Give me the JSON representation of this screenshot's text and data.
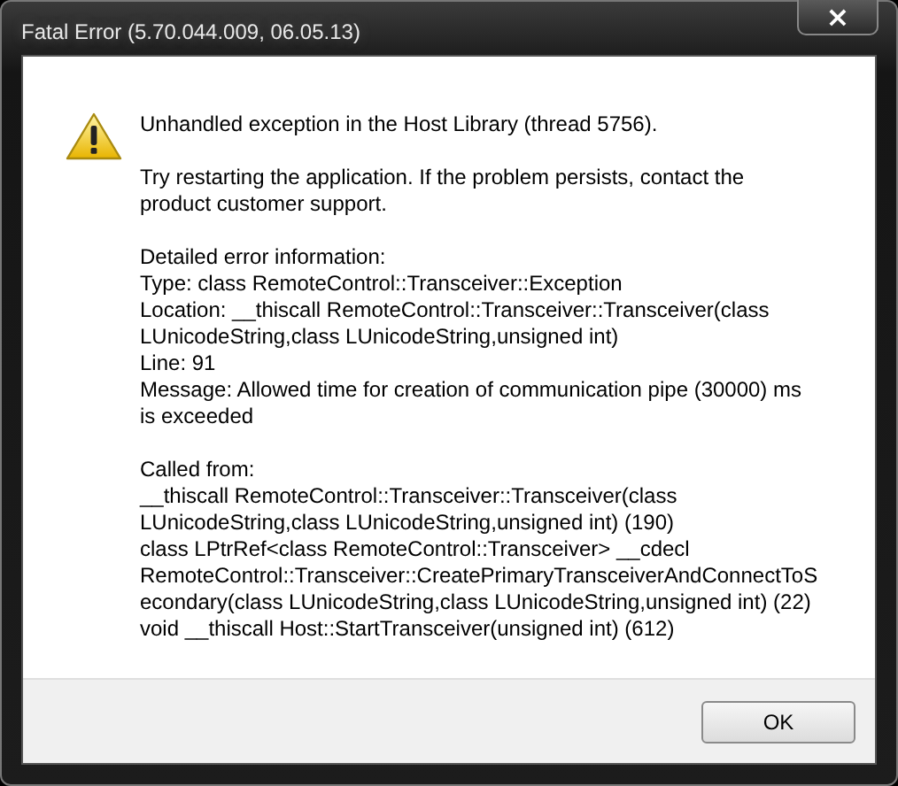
{
  "window": {
    "title": "Fatal Error (5.70.044.009, 06.05.13)",
    "close": "×"
  },
  "message": {
    "headline": [
      "Unhandled exception in the Host Library (thread 5756)."
    ],
    "paragraphs": [
      [
        "Try restarting the application. If the problem persists, contact the",
        "product customer support."
      ],
      [
        "Detailed error information:",
        "Type: class RemoteControl::Transceiver::Exception",
        "Location: __thiscall RemoteControl::Transceiver::Transceiver(class",
        "LUnicodeString,class LUnicodeString,unsigned int)",
        "Line: 91",
        "Message: Allowed time for creation of communication pipe (30000) ms",
        "is exceeded"
      ],
      [
        "Called from:",
        "__thiscall RemoteControl::Transceiver::Transceiver(class",
        "LUnicodeString,class LUnicodeString,unsigned int) (190)",
        "class LPtrRef<class RemoteControl::Transceiver> __cdecl",
        "RemoteControl::Transceiver::CreatePrimaryTransceiverAndConnectToS",
        "econdary(class LUnicodeString,class LUnicodeString,unsigned int) (22)",
        "void __thiscall Host::StartTransceiver(unsigned int) (612)"
      ]
    ]
  },
  "buttons": [
    "OK"
  ]
}
